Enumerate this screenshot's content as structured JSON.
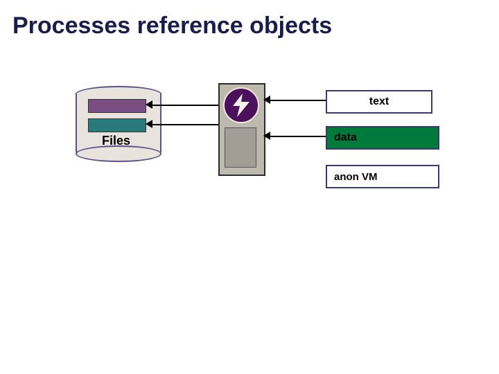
{
  "title": "Processes reference objects",
  "files_label": "Files",
  "segments": {
    "text": "text",
    "data": "data",
    "anon": "anon VM"
  },
  "icons": {
    "bolt": "bolt-icon",
    "cylinder": "database-cylinder"
  }
}
